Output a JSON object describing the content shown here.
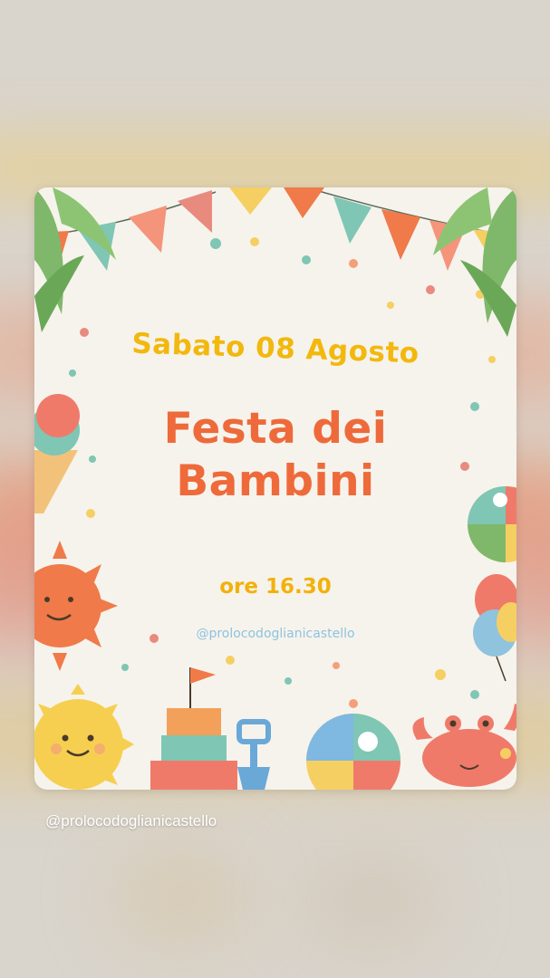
{
  "story": {
    "caption": "@prolocodoglianicastello"
  },
  "poster": {
    "date": "Sabato 08 Agosto",
    "title_line1": "Festa dei",
    "title_line2": "Bambini",
    "time": "ore 16.30",
    "handle": "@prolocodoglianicastello"
  },
  "colors": {
    "date": "#f2b80e",
    "title": "#ee6a3a",
    "time": "#f2b10c",
    "handle": "#8fc3de",
    "card_background": "#f6f3ec"
  },
  "icons": [
    "bunting-flags-icon",
    "palm-leaves-icon",
    "ice-cream-icon",
    "sun-icon",
    "beach-ball-icon",
    "sandcastle-icon",
    "shovel-icon",
    "crab-icon",
    "balloons-icon",
    "confetti-dots-icon"
  ]
}
